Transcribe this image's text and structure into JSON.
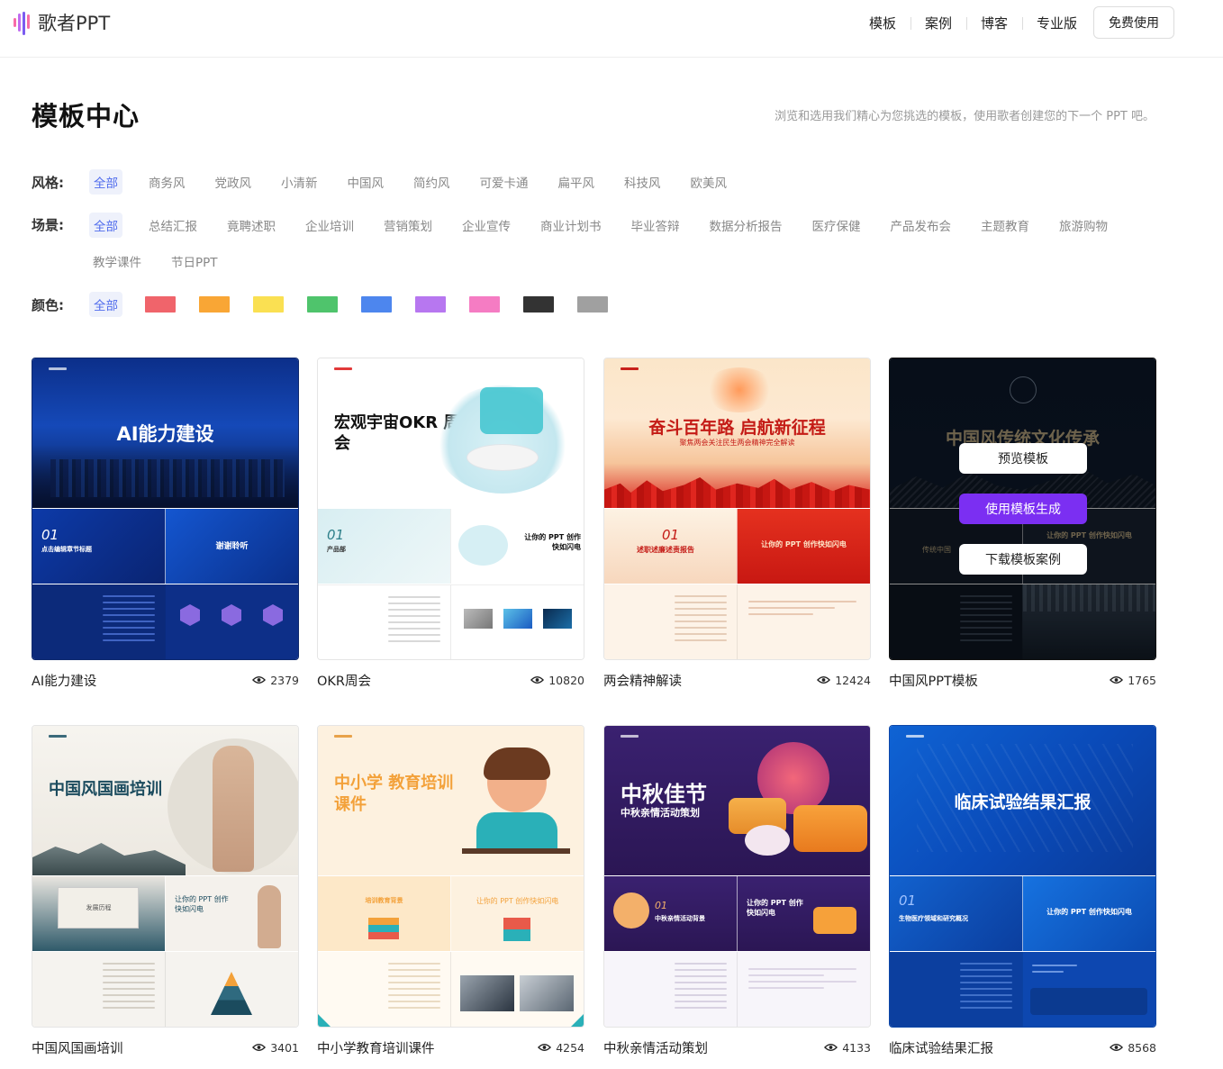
{
  "header": {
    "brand": "歌者PPT",
    "nav": [
      "模板",
      "案例",
      "博客",
      "专业版"
    ],
    "cta": "免费使用"
  },
  "page": {
    "title": "模板中心",
    "subtitle": "浏览和选用我们精心为您挑选的模板，使用歌者创建您的下一个 PPT 吧。"
  },
  "filters": {
    "style": {
      "label": "风格:",
      "options": [
        "全部",
        "商务风",
        "党政风",
        "小清新",
        "中国风",
        "简约风",
        "可爱卡通",
        "扁平风",
        "科技风",
        "欧美风"
      ],
      "selected": "全部"
    },
    "scene": {
      "label": "场景:",
      "options": [
        "全部",
        "总结汇报",
        "竟聘述职",
        "企业培训",
        "营销策划",
        "企业宣传",
        "商业计划书",
        "毕业答辩",
        "数据分析报告",
        "医疗保健",
        "产品发布会",
        "主题教育",
        "旅游购物",
        "教学课件",
        "节日PPT"
      ],
      "selected": "全部"
    },
    "color": {
      "label": "颜色:",
      "all_label": "全部",
      "swatches": [
        "#f0646b",
        "#f9a635",
        "#fae052",
        "#4fc46c",
        "#4d86ee",
        "#b777f0",
        "#f57cc3",
        "#333333",
        "#a0a0a0"
      ]
    }
  },
  "templates": [
    {
      "name": "AI能力建设",
      "views": "2379",
      "cover_title": "AI能力建设",
      "mid_left": "点击编辑章节标题",
      "mid_right": "谢谢聆听"
    },
    {
      "name": "OKR周会",
      "views": "10820",
      "cover_title": "宏观宇宙OKR 周会",
      "mid_left": "产品部",
      "mid_right": "让你的 PPT 创作快如闪电"
    },
    {
      "name": "两会精神解读",
      "views": "12424",
      "cover_title": "奋斗百年路 启航新征程",
      "cover_sub": "聚焦两会关注民生两会精神完全解读",
      "mid_left": "述职述廉述责报告",
      "mid_right": "让你的 PPT 创作快如闪电"
    },
    {
      "name": "中国风PPT模板",
      "views": "1765",
      "cover_title": "中国风传统文化传承",
      "mid_left": "传统中国",
      "mid_right": "让你的 PPT 创作快如闪电"
    },
    {
      "name": "中国风国画培训",
      "views": "3401",
      "cover_title": "中国风国画培训",
      "mid_left": "发展历程",
      "mid_right": "让你的 PPT 创作快如闪电"
    },
    {
      "name": "中小学教育培训课件",
      "views": "4254",
      "cover_title": "中小学 教育培训课件",
      "mid_left": "培训教育背景",
      "mid_right": "让你的 PPT 创作快如闪电"
    },
    {
      "name": "中秋亲情活动策划",
      "views": "4133",
      "cover_title": "中秋佳节",
      "cover_sub": "中秋亲情活动策划",
      "mid_left": "中秋亲情活动背景",
      "mid_right": "让你的 PPT 创作快如闪电"
    },
    {
      "name": "临床试验结果汇报",
      "views": "8568",
      "cover_title": "临床试验结果汇报",
      "mid_left": "生物医疗领域和研究概况",
      "mid_right": "让你的 PPT 创作快如闪电"
    }
  ],
  "hover_actions": {
    "preview": "预览模板",
    "generate": "使用模板生成",
    "download": "下载模板案例"
  },
  "icons": {
    "view": "eye-icon",
    "logo": "sound-wave-logo-icon"
  }
}
